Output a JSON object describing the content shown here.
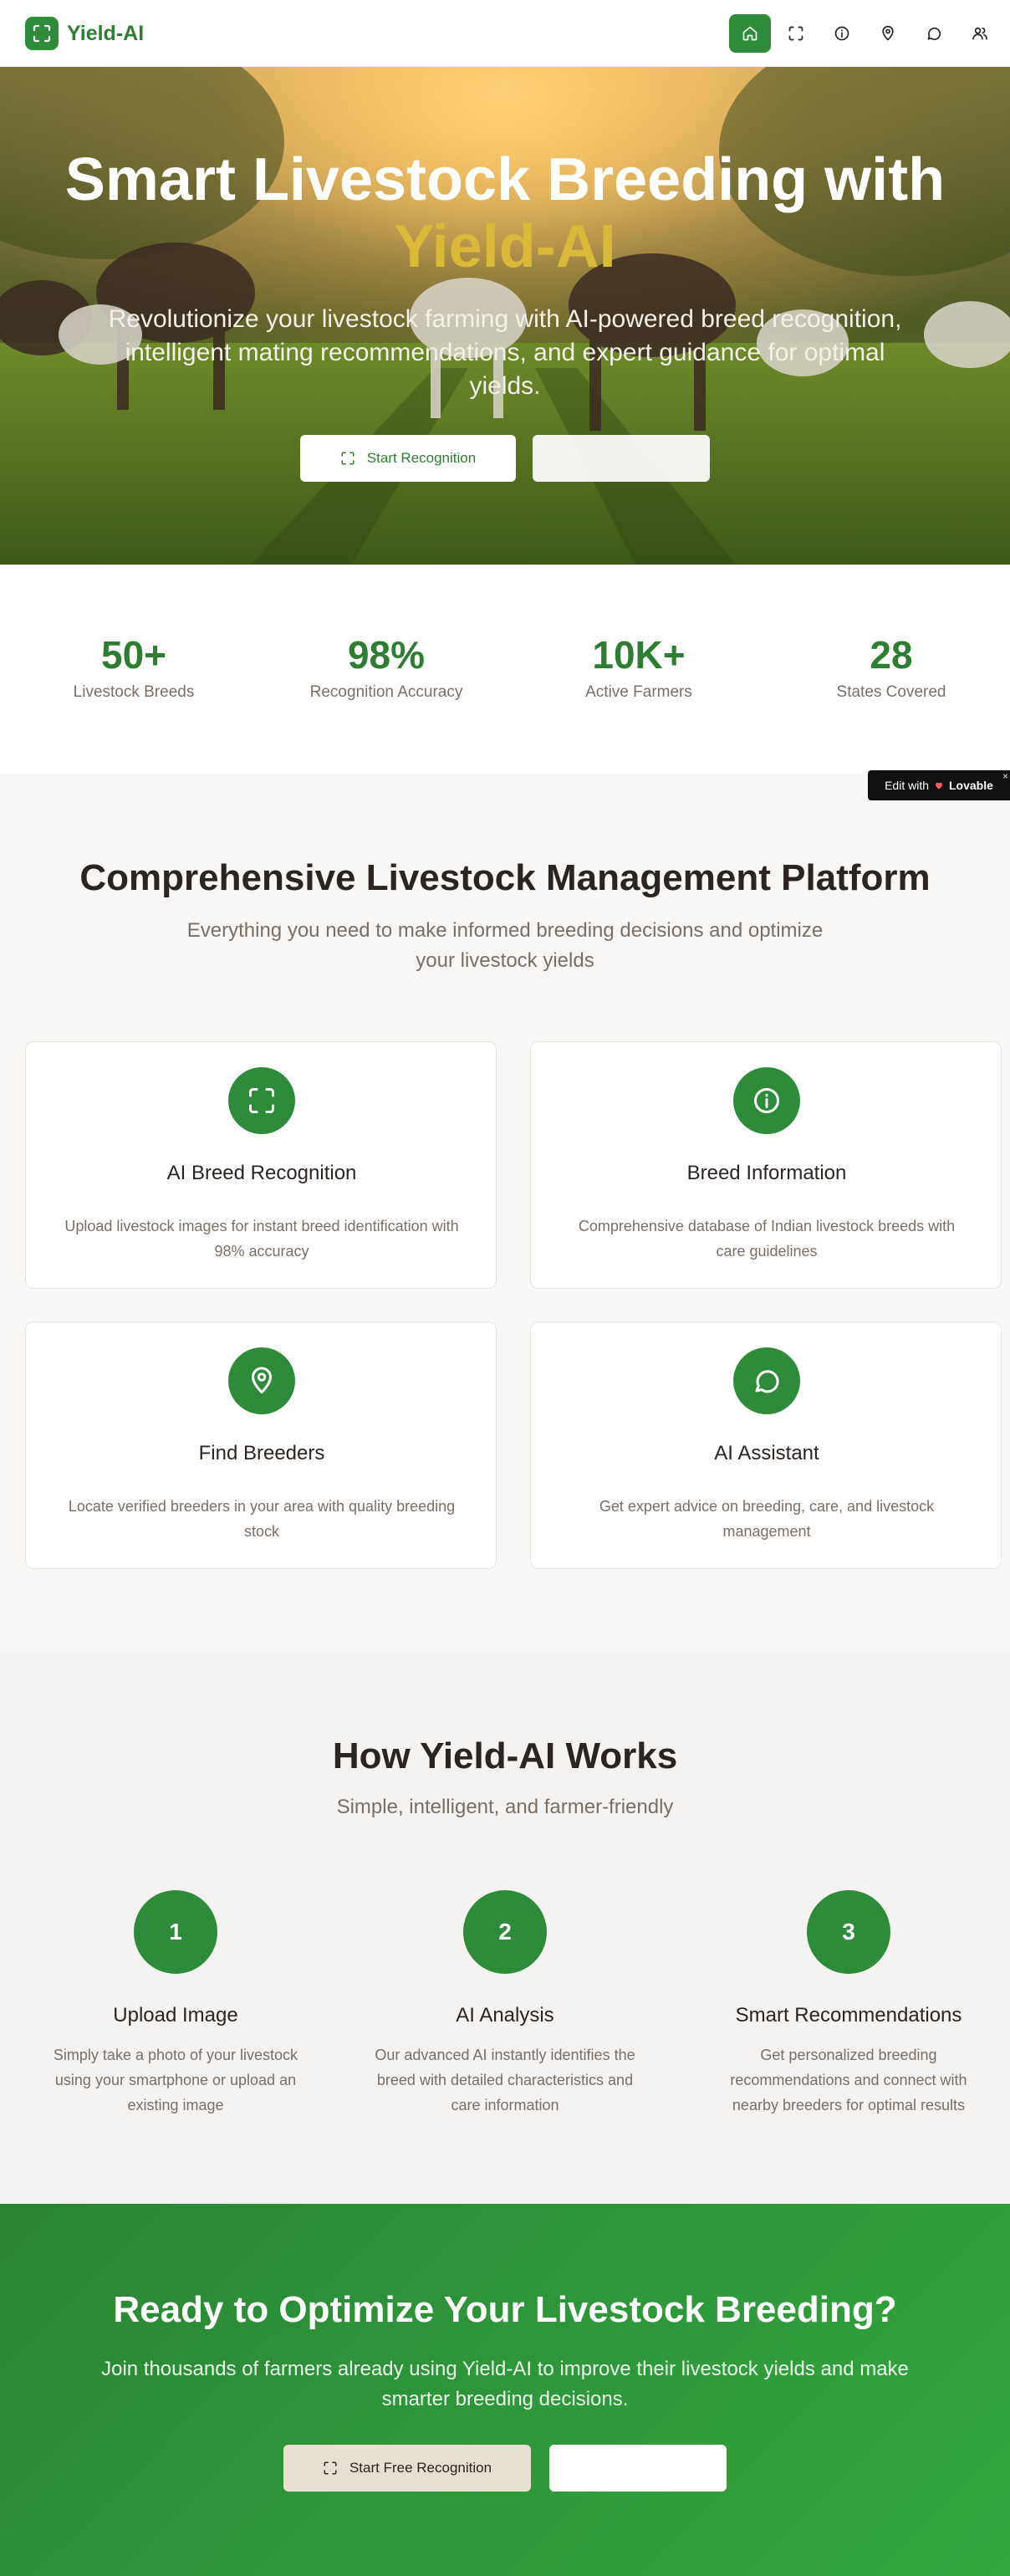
{
  "brand": {
    "name": "Yield-AI",
    "logo_icon": "scan-icon"
  },
  "nav": {
    "items": [
      {
        "icon": "home-icon",
        "active": true
      },
      {
        "icon": "scan-icon",
        "active": false
      },
      {
        "icon": "info-icon",
        "active": false
      },
      {
        "icon": "map-pin-icon",
        "active": false
      },
      {
        "icon": "chat-icon",
        "active": false
      },
      {
        "icon": "users-icon",
        "active": false
      }
    ]
  },
  "hero": {
    "title": "Smart Livestock Breeding with",
    "title_highlight": "Yield-AI",
    "subtitle": "Revolutionize your livestock farming with AI-powered breed recognition, intelligent mating recommendations, and expert guidance for optimal yields.",
    "primary_button": "Start Recognition",
    "secondary_button": ""
  },
  "stats": [
    {
      "value": "50+",
      "label": "Livestock Breeds"
    },
    {
      "value": "98%",
      "label": "Recognition Accuracy"
    },
    {
      "value": "10K+",
      "label": "Active Farmers"
    },
    {
      "value": "28",
      "label": "States Covered"
    }
  ],
  "badge": {
    "prefix": "Edit with",
    "brand": "Lovable",
    "close": "×"
  },
  "features": {
    "title": "Comprehensive Livestock Management Platform",
    "subtitle": "Everything you need to make informed breeding decisions and optimize your livestock yields",
    "cards": [
      {
        "icon": "scan-icon",
        "title": "AI Breed Recognition",
        "desc": "Upload livestock images for instant breed identification with 98% accuracy"
      },
      {
        "icon": "info-icon",
        "title": "Breed Information",
        "desc": "Comprehensive database of Indian livestock breeds with care guidelines"
      },
      {
        "icon": "map-pin-icon",
        "title": "Find Breeders",
        "desc": "Locate verified breeders in your area with quality breeding stock"
      },
      {
        "icon": "chat-icon",
        "title": "AI Assistant",
        "desc": "Get expert advice on breeding, care, and livestock management"
      }
    ]
  },
  "how": {
    "title": "How Yield-AI Works",
    "subtitle": "Simple, intelligent, and farmer-friendly",
    "steps": [
      {
        "num": "1",
        "title": "Upload Image",
        "desc": "Simply take a photo of your livestock using your smartphone or upload an existing image"
      },
      {
        "num": "2",
        "title": "AI Analysis",
        "desc": "Our advanced AI instantly identifies the breed with detailed characteristics and care information"
      },
      {
        "num": "3",
        "title": "Smart Recommendations",
        "desc": "Get personalized breeding recommendations and connect with nearby breeders for optimal results"
      }
    ]
  },
  "cta": {
    "title": "Ready to Optimize Your Livestock Breeding?",
    "subtitle": "Join thousands of farmers already using Yield-AI to improve their livestock yields and make smarter breeding decisions.",
    "primary_button": "Start Free Recognition",
    "secondary_button": ""
  },
  "colors": {
    "primary": "#2e8b3a",
    "primary_text": "#2e7d32",
    "highlight": "#d9b93a",
    "muted": "#7a6e65"
  }
}
